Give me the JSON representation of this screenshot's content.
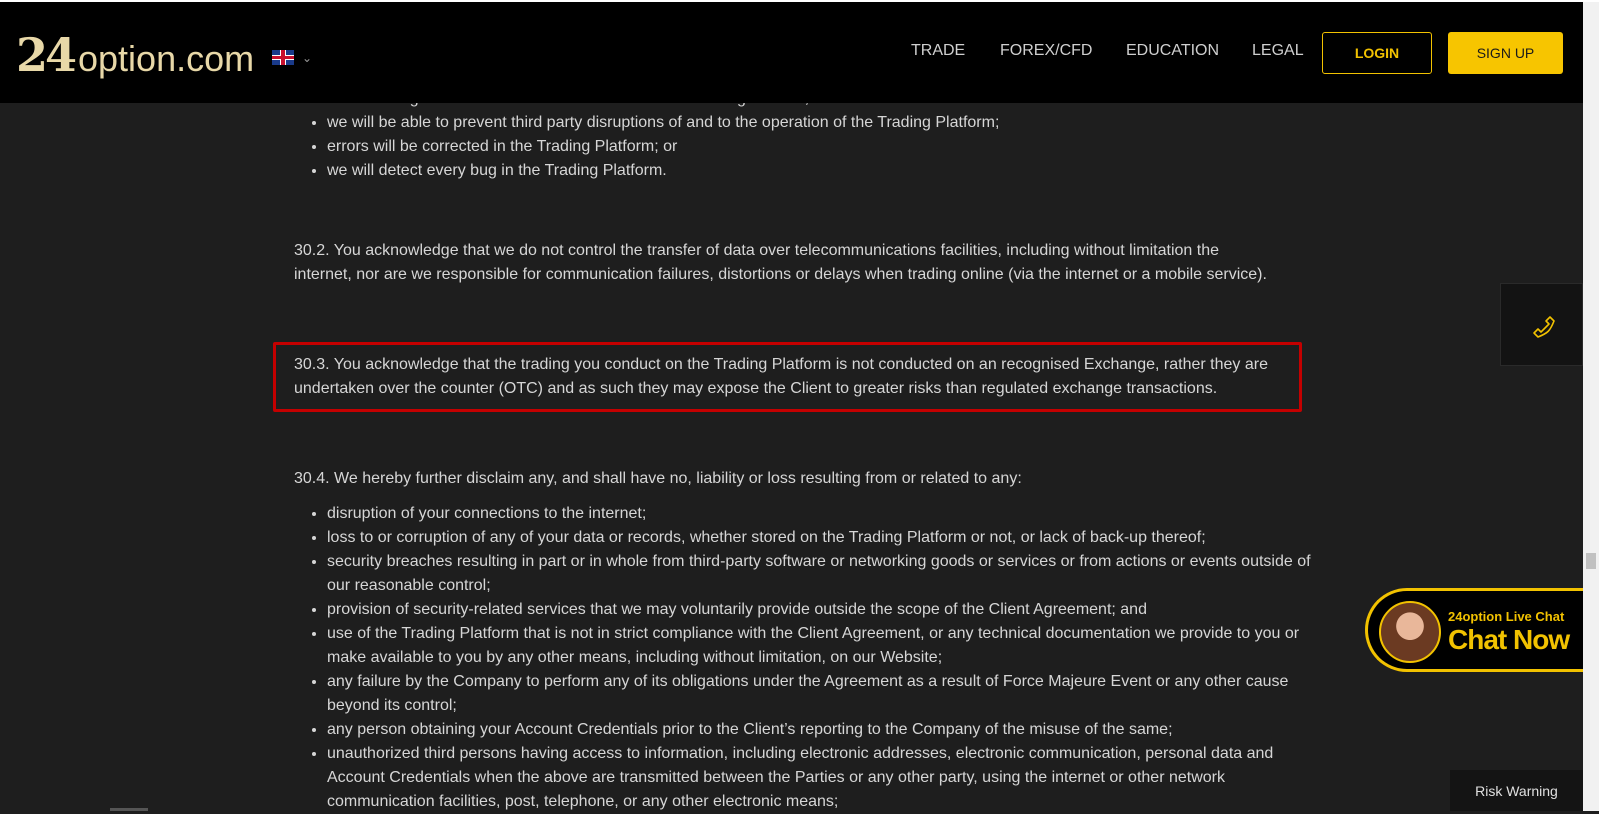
{
  "header": {
    "logo_number": "24",
    "logo_text": "option.com",
    "nav": [
      "TRADE",
      "FOREX/CFD",
      "EDUCATION",
      "LEGAL"
    ],
    "login_label": "LOGIN",
    "signup_label": "SIGN UP"
  },
  "content": {
    "partial_line": "errors or bugs shall not constitute a breach of this Client Agreement;",
    "bullets_top": [
      "we will be able to prevent third party disruptions of and to the operation of the Trading Platform;",
      "errors will be corrected in the Trading Platform; or",
      "we will detect every bug in the Trading Platform."
    ],
    "p302": "30.2. You acknowledge that we do not control the transfer of data over telecommunications facilities, including without limitation the internet, nor are we responsible for communication failures, distortions or delays when trading online (via the internet or a mobile service).",
    "p303": "30.3. You acknowledge that the trading you conduct on the Trading Platform is not conducted on an recognised Exchange, rather they are undertaken over the counter (OTC) and as such they may expose the Client to greater risks than regulated exchange transactions.",
    "p304": "30.4. We hereby further disclaim any, and shall have no, liability or loss resulting from or related to any:",
    "bullets_bottom": [
      "disruption of your connections to the internet;",
      "loss to or corruption of any of your data or records, whether stored on the Trading Platform or not, or lack of back-up thereof;",
      "security breaches resulting in part or in whole from third-party software or networking goods or services or from actions or events outside of our reasonable control;",
      "provision of security-related services that we may voluntarily provide outside the scope of the Client Agreement; and",
      "use of the Trading Platform that is not in strict compliance with the Client Agreement, or any technical documentation we provide to you or make available to you by any other means, including without limitation, on our Website;",
      "any failure by the Company to perform any of its obligations under the Agreement as a result of Force Majeure Event or any other cause beyond its control;",
      "any person obtaining your Account Credentials prior to the Client’s reporting to the Company of the misuse of the same;",
      "unauthorized third persons having access to information, including electronic addresses, electronic communication, personal data and Account Credentials when the above are transmitted between the Parties or any other party, using the internet or other network communication facilities, post, telephone, or any other electronic means;"
    ]
  },
  "chat": {
    "title": "24option Live Chat",
    "cta": "Chat Now"
  },
  "risk_warning": "Risk Warning",
  "colors": {
    "accent": "#f2c200",
    "highlight_border": "#c40000",
    "background": "#1e1e1e"
  }
}
